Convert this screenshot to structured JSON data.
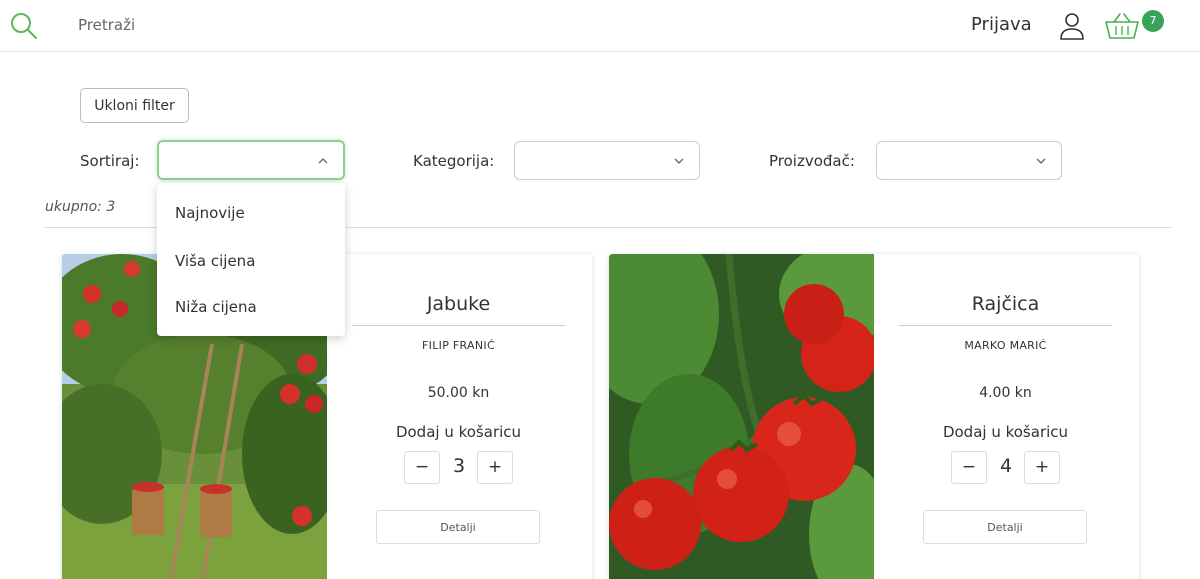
{
  "header": {
    "search_placeholder": "Pretraži",
    "login_label": "Prijava",
    "cart_count": "7",
    "accent_color": "#3aa35a"
  },
  "filters": {
    "clear_label": "Ukloni filter",
    "sort_label": "Sortiraj:",
    "category_label": "Kategorija:",
    "producer_label": "Proizvođač:",
    "sort_options": [
      "Najnovije",
      "Viša cijena",
      "Niža cijena"
    ]
  },
  "results": {
    "total_text": "ukupno: 3"
  },
  "products": [
    {
      "name": "Jabuke",
      "producer": "FILIP FRANIĆ",
      "price": "50.00 kn",
      "add_label": "Dodaj u košaricu",
      "quantity": "3",
      "details_label": "Detalji",
      "image_icon": "apple-orchard-image"
    },
    {
      "name": "Rajčica",
      "producer": "MARKO MARIĆ",
      "price": "4.00 kn",
      "add_label": "Dodaj u košaricu",
      "quantity": "4",
      "details_label": "Detalji",
      "image_icon": "tomato-image"
    }
  ],
  "qty_controls": {
    "minus": "−",
    "plus": "+"
  }
}
